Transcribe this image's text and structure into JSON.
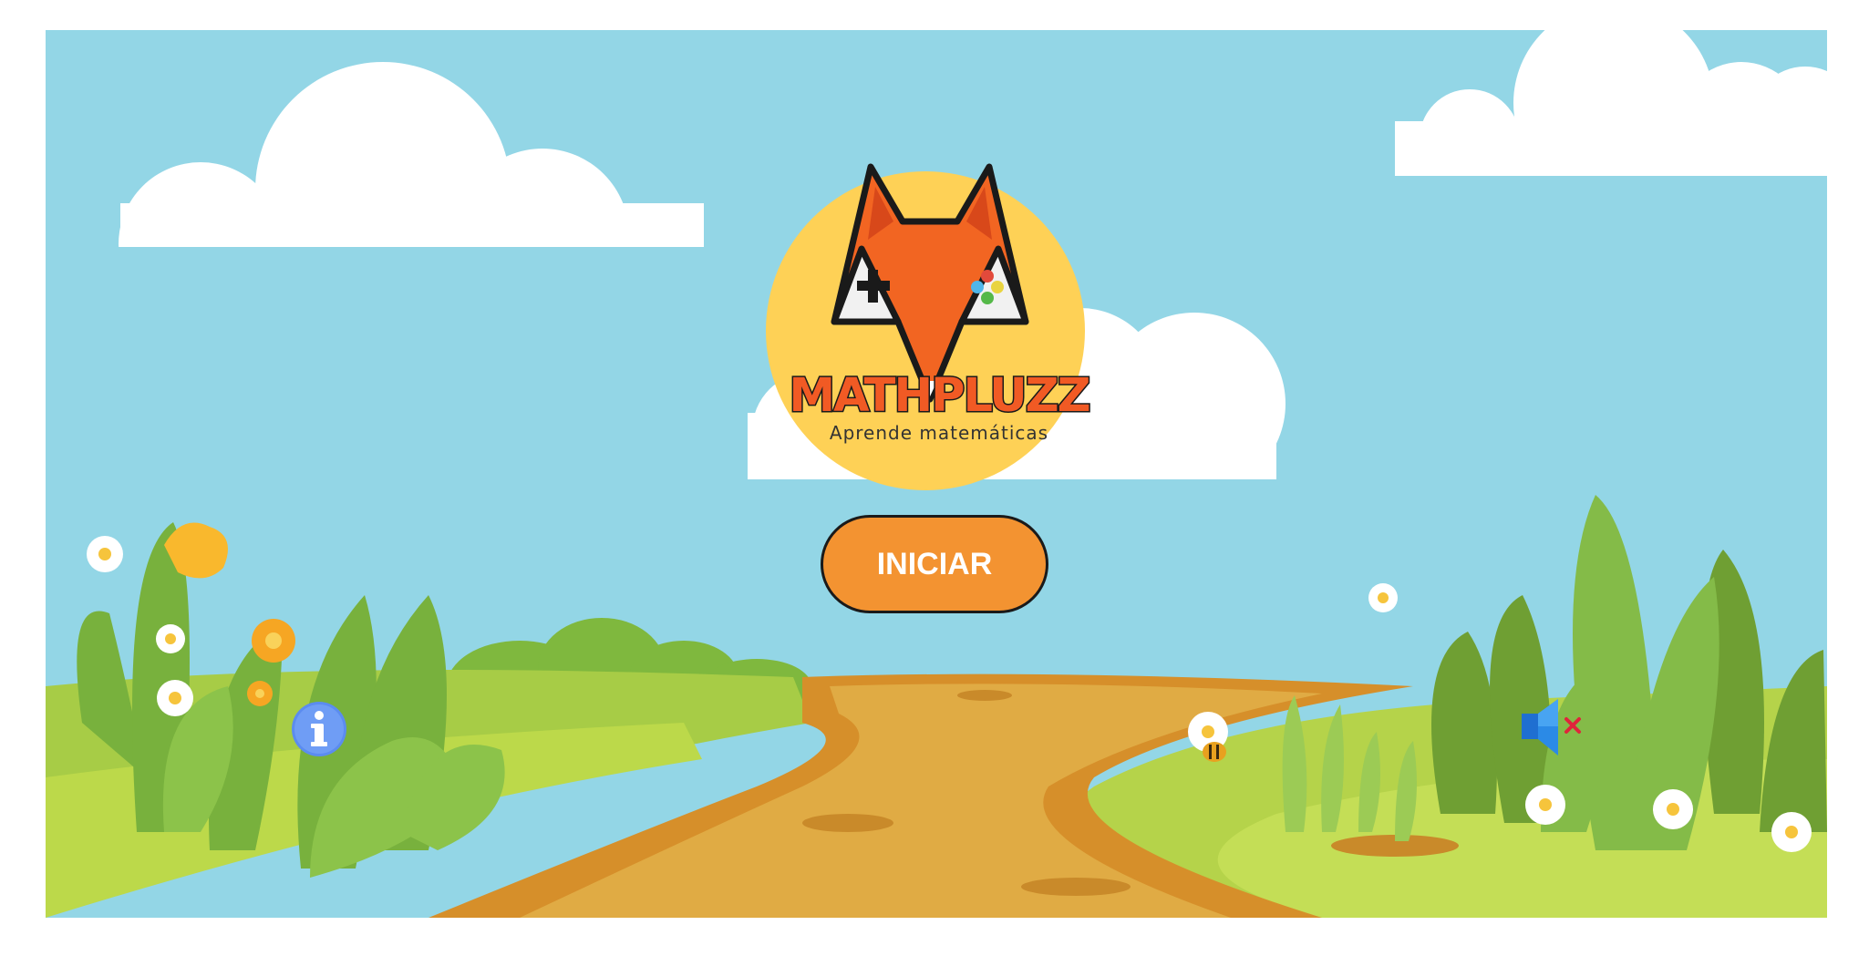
{
  "game": {
    "title": "MATHPLUZZ",
    "subtitle": "Aprende matemáticas",
    "start_label": "INICIAR"
  },
  "controls": {
    "info_icon": "info-icon",
    "sound_icon": "speaker-muted-icon",
    "sound_muted": true
  },
  "colors": {
    "sky": "#93d6e6",
    "sun": "#fed156",
    "fox": "#f26522",
    "button": "#f39331",
    "path": "#dba33d",
    "grass": "#b5d34a"
  }
}
